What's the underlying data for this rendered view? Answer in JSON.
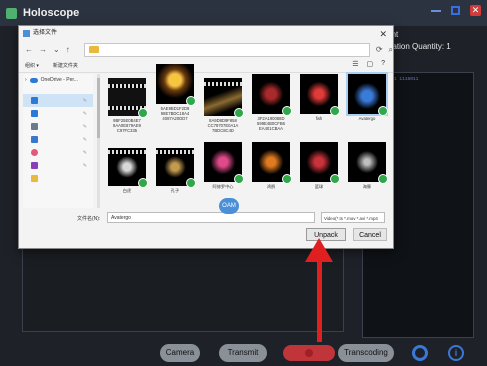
{
  "window": {
    "title": "Holoscope"
  },
  "right_header": {
    "line1": "Equipment",
    "line2": "...chronization  Quantity: 1",
    "line3": "00"
  },
  "right_panel": {
    "code": "... 8000.01 1116011"
  },
  "toolbar": {
    "camera": "Camera",
    "transmit": "Transmit",
    "transcoding": "Transcoding"
  },
  "dialog": {
    "title": "选择文件",
    "cmd1": "组织 ▾",
    "cmd2": "新建文件夹",
    "nav_root": "OneDrive - Per...",
    "filename_label": "文件名(N):",
    "filename_value": "Avatergo",
    "filter": "Video(*.ts *.mov *.avi *.mp4",
    "unpack": "Unpack",
    "cancel": "Cancel",
    "cursor_label": "OAM",
    "items": [
      {
        "caption": "9BF25E0B4E7 8AA0E879AE9 C97FC335"
      },
      {
        "caption": "5AE9BD1F2D8 98E7BDC18A4 4087A20DD7"
      },
      {
        "caption": "8A9D8D9F858 CC78707E0A1A 7BDC8C4D"
      },
      {
        "caption": "3F2A190088D 599E4B0CFB6 EA401CBAA"
      },
      {
        "caption": "fish"
      },
      {
        "caption": "Avatergo"
      },
      {
        "caption": "白虎"
      },
      {
        "caption": "孔子"
      },
      {
        "caption": "阿修罗中心"
      },
      {
        "caption": "鸿鹄"
      },
      {
        "caption": "篮球"
      },
      {
        "caption": "海豚"
      }
    ]
  }
}
